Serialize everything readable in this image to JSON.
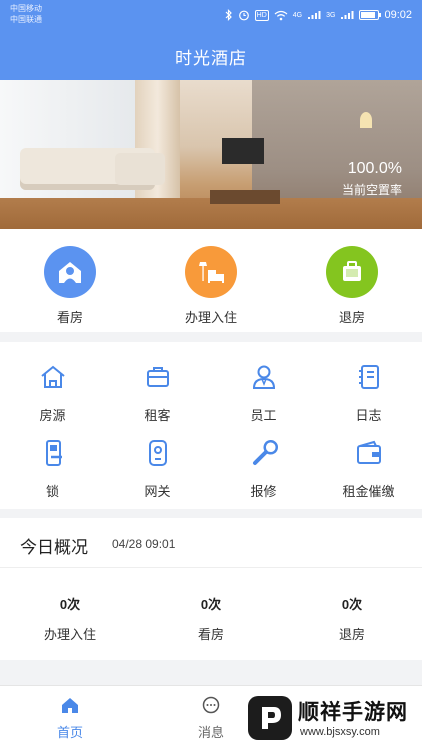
{
  "status_bar": {
    "carrier1": "中国移动",
    "carrier2": "中国联通",
    "network1": "4G",
    "network2": "3G",
    "hd": "HD",
    "time": "09:02"
  },
  "header": {
    "title": "时光酒店"
  },
  "banner": {
    "vacancy_value": "100.0%",
    "vacancy_label": "当前空置率"
  },
  "actions": [
    {
      "label": "看房",
      "icon": "house-person-icon",
      "color": "#5b93f0"
    },
    {
      "label": "办理入住",
      "icon": "lamp-bed-icon",
      "color": "#f89a3a"
    },
    {
      "label": "退房",
      "icon": "luggage-icon",
      "color": "#84c51f"
    }
  ],
  "grid": [
    {
      "label": "房源",
      "icon": "house-icon"
    },
    {
      "label": "租客",
      "icon": "briefcase-icon"
    },
    {
      "label": "员工",
      "icon": "staff-icon"
    },
    {
      "label": "日志",
      "icon": "notebook-icon"
    },
    {
      "label": "锁",
      "icon": "door-lock-icon"
    },
    {
      "label": "网关",
      "icon": "gateway-icon"
    },
    {
      "label": "报修",
      "icon": "wrench-icon"
    },
    {
      "label": "租金催缴",
      "icon": "wallet-icon"
    }
  ],
  "today": {
    "title": "今日概况",
    "datetime": "04/28 09:01",
    "stats": [
      {
        "count": "0次",
        "label": "办理入住"
      },
      {
        "count": "0次",
        "label": "看房"
      },
      {
        "count": "0次",
        "label": "退房"
      }
    ]
  },
  "bottom_nav": [
    {
      "label": "首页",
      "icon": "home-icon",
      "active": true
    },
    {
      "label": "消息",
      "icon": "chat-icon",
      "active": false
    }
  ],
  "watermark": {
    "name": "顺祥手游网",
    "url": "www.bjsxsy.com"
  },
  "colors": {
    "primary": "#5b93f0",
    "orange": "#f89a3a",
    "green": "#84c51f",
    "icon_blue": "#4a88e8"
  }
}
